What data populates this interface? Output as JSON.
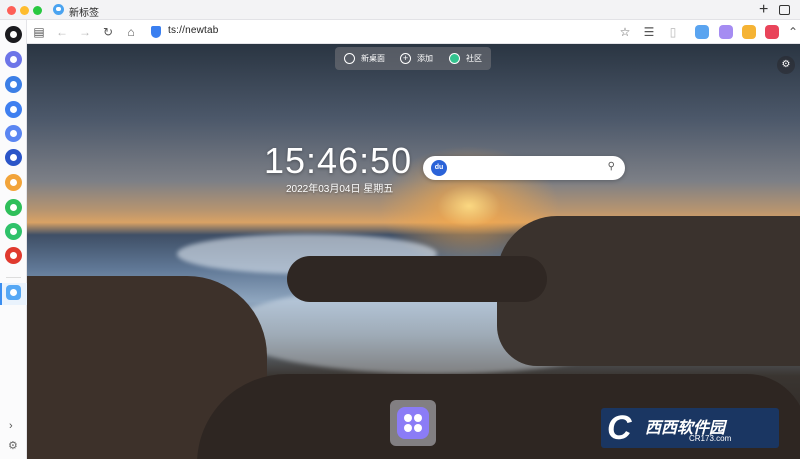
{
  "window": {
    "tab_title": "新标签",
    "new_tab_symbol": "+"
  },
  "navbar": {
    "url": "ts://newtab"
  },
  "sidebar": {
    "apps": [
      {
        "name": "sidebar-app-1",
        "color": "#1b1b1f"
      },
      {
        "name": "sidebar-app-2",
        "color": "#6d75e8"
      },
      {
        "name": "sidebar-app-wechat",
        "color": "#3c7fe6"
      },
      {
        "name": "sidebar-app-3",
        "color": "#3f7ff0"
      },
      {
        "name": "sidebar-app-4",
        "color": "#5b86f2"
      },
      {
        "name": "sidebar-app-5",
        "color": "#2b55c8"
      },
      {
        "name": "sidebar-app-6",
        "color": "#f2a43a"
      },
      {
        "name": "sidebar-app-7",
        "color": "#2fbf5a"
      },
      {
        "name": "sidebar-app-8",
        "color": "#2fc26a"
      },
      {
        "name": "sidebar-app-9",
        "color": "#e03a2f"
      }
    ]
  },
  "topmenu": {
    "items": [
      {
        "label": "新桌面"
      },
      {
        "label": "添加"
      },
      {
        "label": "社区"
      }
    ]
  },
  "clock": {
    "time": "15:46:50",
    "date": "2022年03月04日  星期五"
  },
  "search": {
    "engine_label": "du"
  },
  "watermark": {
    "main": "西西软件园",
    "sub": "CR173.com"
  },
  "colors": {
    "accent": "#3b8ef0",
    "dock_app": "#8b7cf6"
  }
}
